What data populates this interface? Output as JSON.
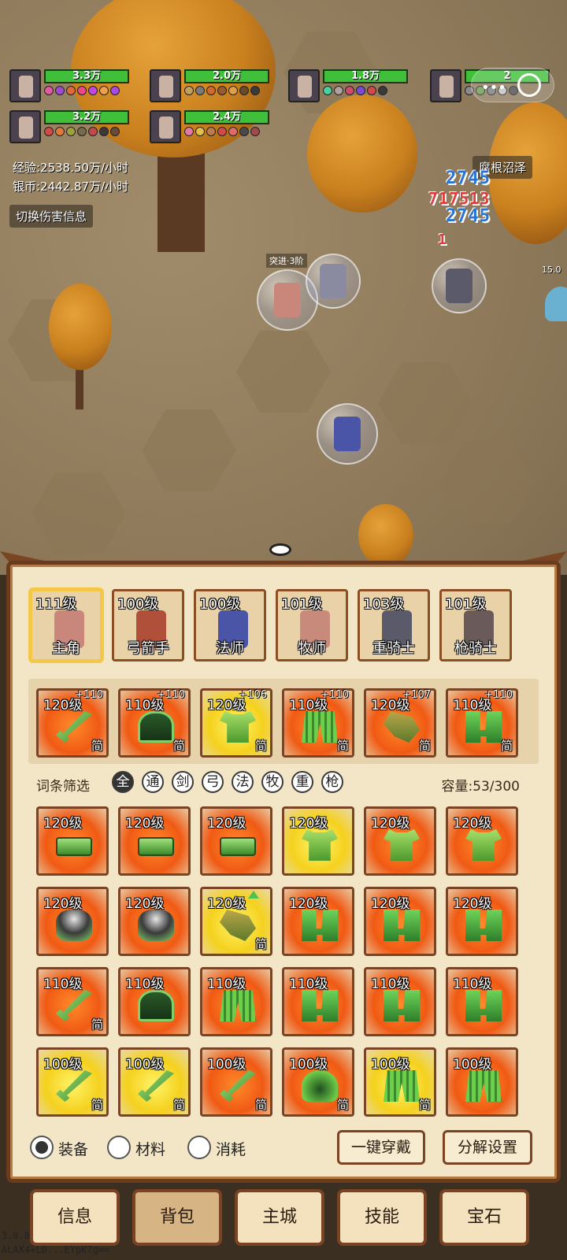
{
  "scene": {
    "team": [
      {
        "hp": "3.3万",
        "selected": true
      },
      {
        "hp": "2.0万",
        "selected": false
      },
      {
        "hp": "1.8万",
        "selected": false
      },
      {
        "hp": "2",
        "selected": false
      },
      {
        "hp": "3.2万",
        "selected": false
      },
      {
        "hp": "2.4万",
        "selected": false
      }
    ],
    "exp_rate": "经验:2538.50万/小时",
    "silver_rate": "银币:2442.87万/小时",
    "toggle_damage": "切换伤害信息",
    "zone_name": "腐根沼泽",
    "advance_label": "突进·3阶",
    "damage_numbers": [
      "2745",
      "717513",
      "2745",
      "1"
    ],
    "enemy_hp_label": "15.0"
  },
  "heroes": [
    {
      "level": "111级",
      "name": "主角",
      "active": true,
      "color": "#c9867a"
    },
    {
      "level": "100级",
      "name": "弓箭手",
      "active": false,
      "color": "#b0503a"
    },
    {
      "level": "100级",
      "name": "法师",
      "active": false,
      "color": "#4a55a8"
    },
    {
      "level": "101级",
      "name": "牧师",
      "active": false,
      "color": "#c88a7a"
    },
    {
      "level": "103级",
      "name": "重骑士",
      "active": false,
      "color": "#5a5a6a"
    },
    {
      "level": "101级",
      "name": "枪骑士",
      "active": false,
      "color": "#6a5a5a"
    }
  ],
  "equipped": [
    {
      "level": "120级",
      "plus": "+110",
      "tag": "简",
      "type": "sword",
      "bg": "orange"
    },
    {
      "level": "110级",
      "plus": "+110",
      "tag": "简",
      "type": "helm",
      "bg": "orange"
    },
    {
      "level": "120级",
      "plus": "+106",
      "tag": "简",
      "type": "armor",
      "bg": "yellow"
    },
    {
      "level": "110级",
      "plus": "+110",
      "tag": "简",
      "type": "leggings",
      "bg": "orange"
    },
    {
      "level": "120级",
      "plus": "+107",
      "tag": "简",
      "type": "gloves",
      "bg": "orange"
    },
    {
      "level": "110级",
      "plus": "+110",
      "tag": "简",
      "type": "boots",
      "bg": "orange"
    }
  ],
  "filter": {
    "label": "词条筛选",
    "chips": [
      {
        "text": "全",
        "on": true
      },
      {
        "text": "通",
        "on": false
      },
      {
        "text": "剑",
        "on": false
      },
      {
        "text": "弓",
        "on": false
      },
      {
        "text": "法",
        "on": false
      },
      {
        "text": "牧",
        "on": false
      },
      {
        "text": "重",
        "on": false
      },
      {
        "text": "枪",
        "on": false
      }
    ],
    "capacity": "容量:53/300"
  },
  "inventory": [
    {
      "level": "120级",
      "tag": "",
      "type": "belt",
      "bg": "orange",
      "upgrade": false
    },
    {
      "level": "120级",
      "tag": "",
      "type": "belt",
      "bg": "orange",
      "upgrade": false
    },
    {
      "level": "120级",
      "tag": "",
      "type": "belt",
      "bg": "orange",
      "upgrade": false
    },
    {
      "level": "120级",
      "tag": "",
      "type": "armor",
      "bg": "yellow",
      "upgrade": false
    },
    {
      "level": "120级",
      "tag": "",
      "type": "armor",
      "bg": "orange",
      "upgrade": false
    },
    {
      "level": "120级",
      "tag": "",
      "type": "armor",
      "bg": "orange",
      "upgrade": false
    },
    {
      "level": "120级",
      "tag": "",
      "type": "paw",
      "bg": "orange",
      "upgrade": false
    },
    {
      "level": "120级",
      "tag": "",
      "type": "paw",
      "bg": "orange",
      "upgrade": false
    },
    {
      "level": "120级",
      "tag": "简",
      "type": "gloves",
      "bg": "yellow",
      "upgrade": true
    },
    {
      "level": "120级",
      "tag": "",
      "type": "boots",
      "bg": "orange",
      "upgrade": false
    },
    {
      "level": "120级",
      "tag": "",
      "type": "boots",
      "bg": "orange",
      "upgrade": false
    },
    {
      "level": "120级",
      "tag": "",
      "type": "boots",
      "bg": "orange",
      "upgrade": false
    },
    {
      "level": "110级",
      "tag": "简",
      "type": "sword",
      "bg": "orange",
      "upgrade": false
    },
    {
      "level": "110级",
      "tag": "",
      "type": "helm",
      "bg": "orange",
      "upgrade": false
    },
    {
      "level": "110级",
      "tag": "",
      "type": "leggings",
      "bg": "orange",
      "upgrade": false
    },
    {
      "level": "110级",
      "tag": "",
      "type": "boots",
      "bg": "orange",
      "upgrade": false
    },
    {
      "level": "110级",
      "tag": "",
      "type": "boots",
      "bg": "orange",
      "upgrade": false
    },
    {
      "level": "110级",
      "tag": "",
      "type": "boots",
      "bg": "orange",
      "upgrade": false
    },
    {
      "level": "100级",
      "tag": "简",
      "type": "sword",
      "bg": "yellow",
      "upgrade": false
    },
    {
      "level": "100级",
      "tag": "简",
      "type": "sword",
      "bg": "yellow",
      "upgrade": false
    },
    {
      "level": "100级",
      "tag": "简",
      "type": "sword",
      "bg": "orange",
      "upgrade": false
    },
    {
      "level": "100级",
      "tag": "简",
      "type": "cloak",
      "bg": "orange",
      "upgrade": false
    },
    {
      "level": "100级",
      "tag": "简",
      "type": "leggings",
      "bg": "yellow",
      "upgrade": false
    },
    {
      "level": "100级",
      "tag": "",
      "type": "leggings",
      "bg": "orange",
      "upgrade": false
    }
  ],
  "categories": [
    {
      "label": "装备",
      "on": true
    },
    {
      "label": "材料",
      "on": false
    },
    {
      "label": "消耗",
      "on": false
    }
  ],
  "actions": {
    "equip_all": "一键穿戴",
    "decompose_settings": "分解设置"
  },
  "nav": [
    {
      "label": "信息",
      "active": false
    },
    {
      "label": "背包",
      "active": true
    },
    {
      "label": "主城",
      "active": false
    },
    {
      "label": "技能",
      "active": false
    },
    {
      "label": "宝石",
      "active": false
    }
  ],
  "version": "3.8.0",
  "build_id": "ALAX4+LD...EYpK7g=="
}
